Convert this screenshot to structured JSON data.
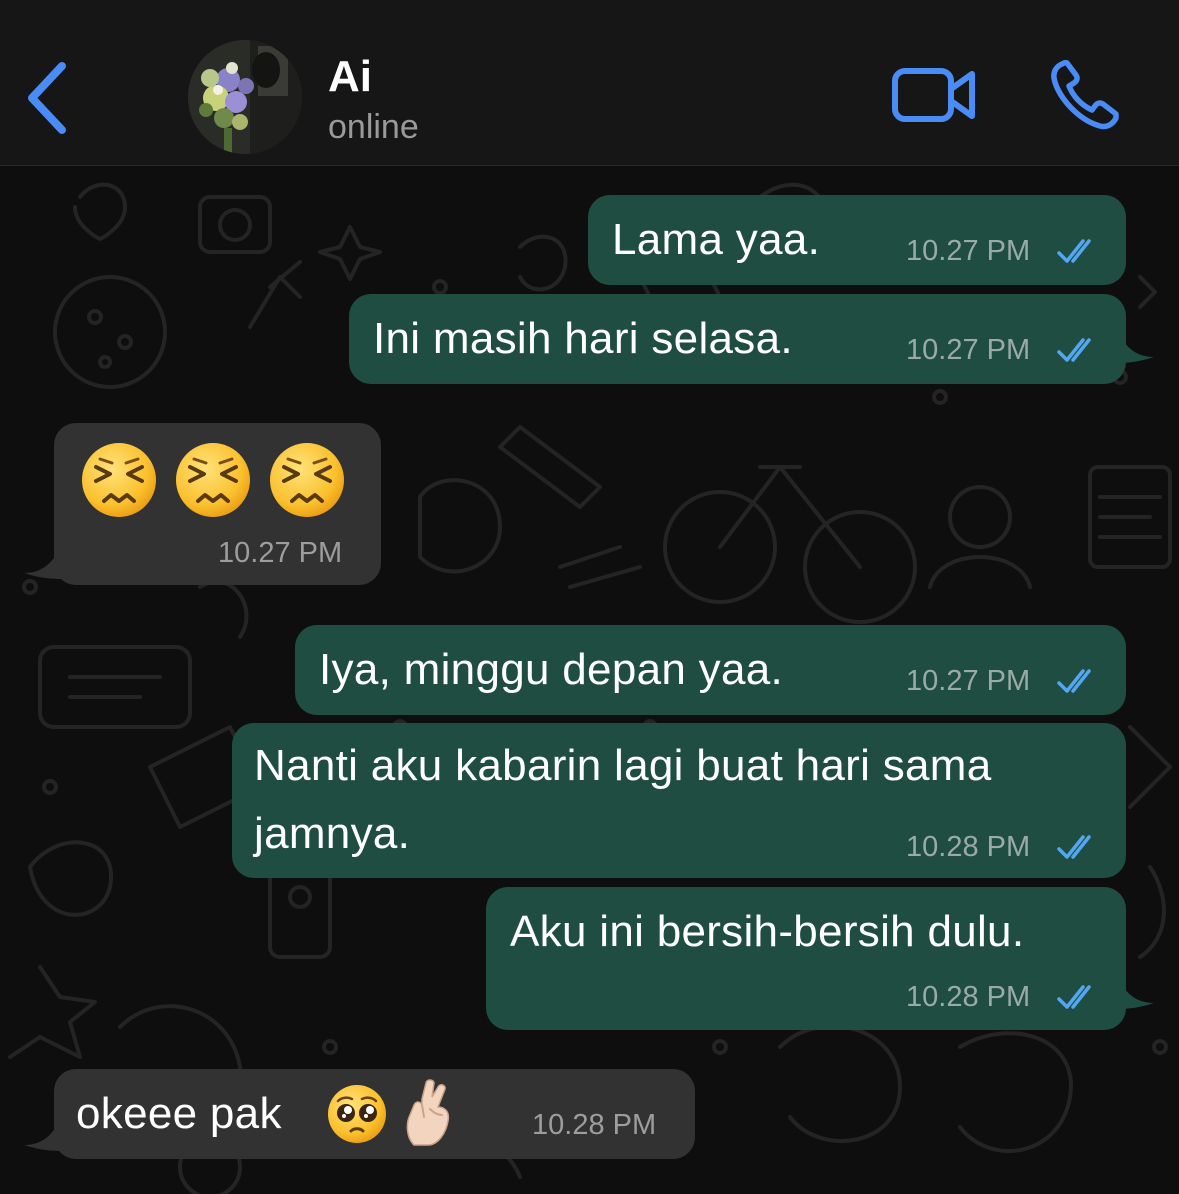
{
  "header": {
    "contact_name": "Ai",
    "status": "online",
    "back_icon": "chevron-left-icon",
    "video_icon": "video-camera-icon",
    "call_icon": "phone-icon",
    "accent_color": "#4a8cf5"
  },
  "messages": [
    {
      "direction": "outgoing",
      "text": "Lama yaa.",
      "time": "10.27 PM",
      "status": "read"
    },
    {
      "direction": "outgoing",
      "text": "Ini masih hari selasa.",
      "time": "10.27 PM",
      "status": "read"
    },
    {
      "direction": "incoming",
      "emojis": [
        "persevering-face",
        "persevering-face",
        "persevering-face"
      ],
      "time": "10.27 PM"
    },
    {
      "direction": "outgoing",
      "text": "Iya, minggu depan yaa.",
      "time": "10.27 PM",
      "status": "read"
    },
    {
      "direction": "outgoing",
      "text_line1": "Nanti aku kabarin lagi buat hari sama",
      "text_line2": "jamnya.",
      "time": "10.28 PM",
      "status": "read"
    },
    {
      "direction": "outgoing",
      "text": "Aku ini bersih-bersih dulu.",
      "time": "10.28 PM",
      "status": "read"
    },
    {
      "direction": "incoming",
      "text": "okeee pak",
      "emojis": [
        "pleading-face",
        "crossed-fingers-light-skin"
      ],
      "time": "10.28 PM"
    }
  ],
  "colors": {
    "outgoing_bubble": "#1f4d42",
    "incoming_bubble": "#323232",
    "read_ticks": "#53a6f0",
    "background": "#0d0d0d"
  }
}
